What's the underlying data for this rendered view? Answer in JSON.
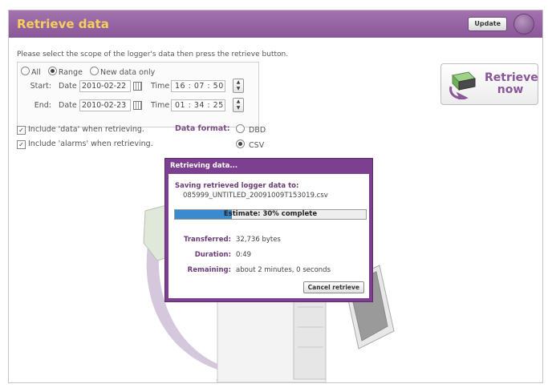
{
  "header": {
    "title": "Retrieve data",
    "update_label": "Update"
  },
  "instructions": "Please select the scope of the logger's data then press the retrieve button.",
  "scope": {
    "options": [
      "All",
      "Range",
      "New data only"
    ],
    "selected": "Range",
    "start": {
      "label": "Start:",
      "date_label": "Date",
      "date": "2010-02-22",
      "time_label": "Time",
      "time": "16 : 07 : 50"
    },
    "end": {
      "label": "End:",
      "date_label": "Date",
      "date": "2010-02-23",
      "time_label": "Time",
      "time": "01 : 34 : 25"
    }
  },
  "include": {
    "data_label": "Include 'data' when retrieving.",
    "alarms_label": "Include 'alarms' when retrieving.",
    "data_checked": true,
    "alarms_checked": true
  },
  "format": {
    "label": "Data format:",
    "options": [
      "DBD",
      "CSV"
    ],
    "selected": "CSV"
  },
  "retrieve_button": {
    "label": "Retrieve\nnow",
    "icon": "logger-download-icon"
  },
  "dialog": {
    "title": "Retrieving data...",
    "saving_label": "Saving retrieved logger data to:",
    "filename": "085999_UNTITLED_20091009T153019.csv",
    "progress_fraction": 0.3,
    "progress_text": "Estimate: 30% complete",
    "transferred_label": "Transferred:",
    "transferred": "32,736 bytes",
    "duration_label": "Duration:",
    "duration": "0:49",
    "remaining_label": "Remaining:",
    "remaining": "about 2 minutes, 0 seconds",
    "cancel_label": "Cancel retrieve"
  },
  "colors": {
    "accent": "#8a5698",
    "title": "#f5d05a",
    "progress": "#3a8ad0"
  }
}
